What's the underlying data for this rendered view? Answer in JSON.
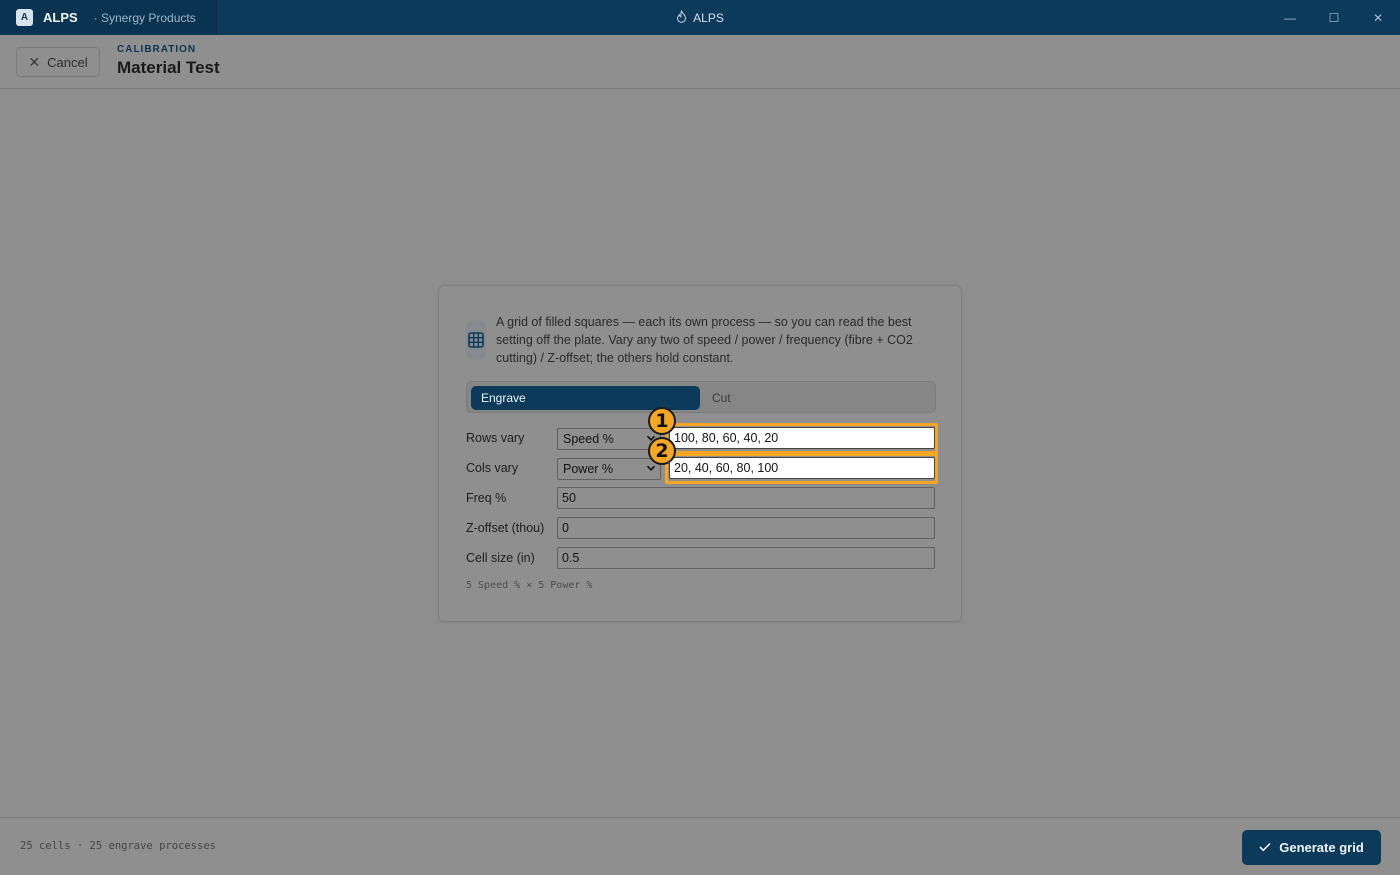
{
  "titlebar": {
    "app_badge": "A",
    "app_name": "ALPS",
    "org": "· Synergy Products",
    "window_title": "ALPS",
    "minimize_glyph": "—",
    "maximize_glyph": "☐",
    "close_glyph": "✕"
  },
  "header": {
    "cancel_label": "Cancel",
    "eyebrow": "CALIBRATION",
    "title": "Material Test"
  },
  "card": {
    "description": "A grid of filled squares — each its own process — so you can read the best setting off the plate. Vary any two of speed / power / frequency (fibre + CO2 cutting) / Z-offset; the others hold constant.",
    "tabs": [
      {
        "label": "Engrave",
        "active": true
      },
      {
        "label": "Cut",
        "active": false
      }
    ],
    "rows": {
      "label": "Rows vary",
      "select": "Speed %",
      "values": "100, 80, 60, 40, 20",
      "marker": "1"
    },
    "cols": {
      "label": "Cols vary",
      "select": "Power %",
      "values": "20, 40, 60, 80, 100",
      "marker": "2"
    },
    "freq": {
      "label": "Freq %",
      "value": "50"
    },
    "zoffset": {
      "label": "Z-offset (thou)",
      "value": "0"
    },
    "cellsize": {
      "label": "Cell size (in)",
      "value": "0.5"
    },
    "summary": "5 Speed % × 5 Power %"
  },
  "footer": {
    "info": "25 cells · 25 engrave processes",
    "generate_label": "Generate grid"
  },
  "colors": {
    "brand": "#0c3a5b",
    "highlight": "#f5a623"
  },
  "icons": [
    "app-badge",
    "flame-icon",
    "close-icon",
    "grid-icon",
    "chevron-down-icon",
    "check-icon"
  ]
}
